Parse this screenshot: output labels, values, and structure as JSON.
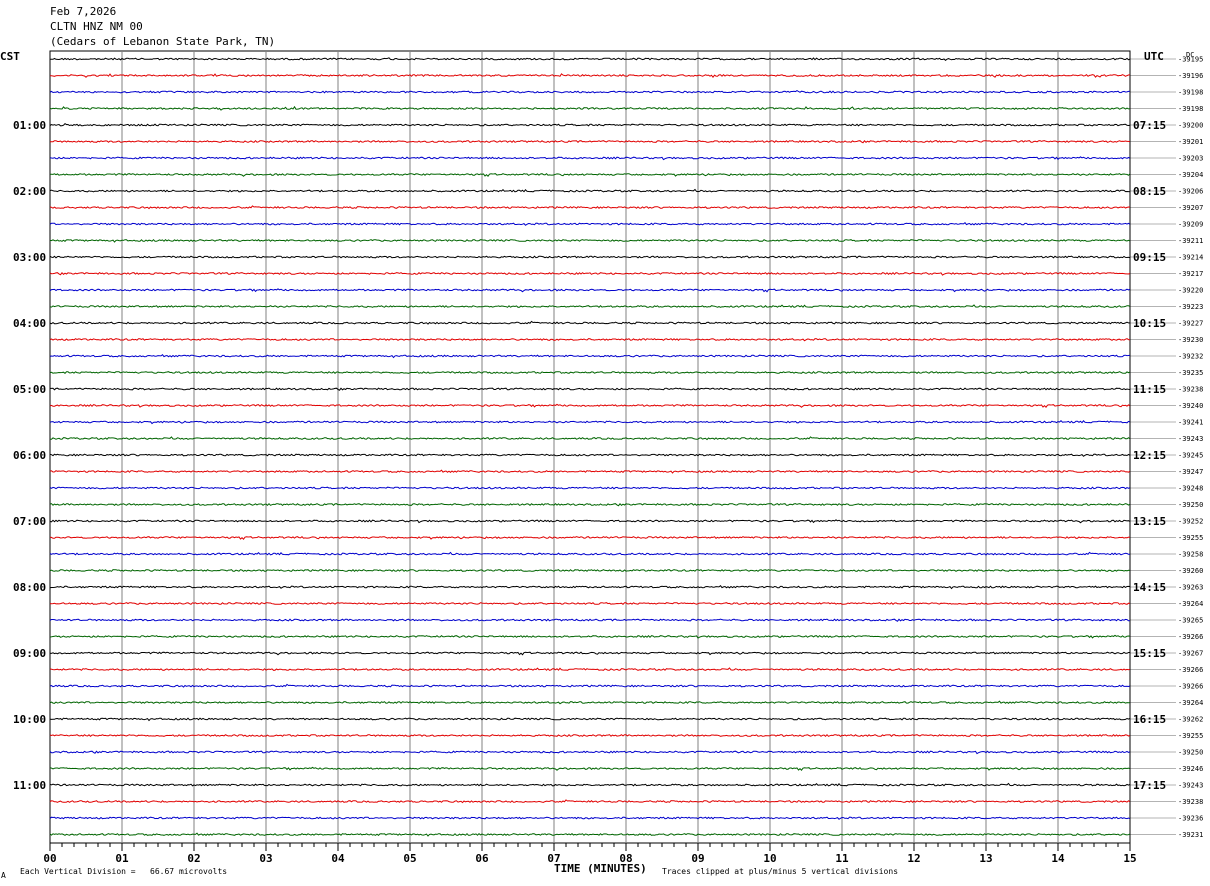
{
  "header": {
    "date": "Feb 7,2026",
    "station": "CLTN HNZ NM 00",
    "location": "(Cedars of Lebanon State Park, TN)"
  },
  "timezones": {
    "left": "CST",
    "right": "UTC"
  },
  "right_top_label": "DC",
  "footer": {
    "scale_note": "Each Vertical Division =   66.67 microvolts",
    "xlabel": "TIME (MINUTES)",
    "clip_note": "Traces clipped at plus/minus 5 vertical divisions",
    "corner_mark": "A"
  },
  "chart_data": {
    "type": "line",
    "title": "",
    "xlabel": "TIME (MINUTES)",
    "xlim": [
      0,
      15
    ],
    "x_ticks": [
      "00",
      "01",
      "02",
      "03",
      "04",
      "05",
      "06",
      "07",
      "08",
      "09",
      "10",
      "11",
      "12",
      "13",
      "14",
      "15"
    ],
    "trace_colors": [
      "#000000",
      "#e00000",
      "#0000cc",
      "#006400"
    ],
    "left_hour_labels": [
      "01:00",
      "02:00",
      "03:00",
      "04:00",
      "05:00",
      "06:00",
      "07:00",
      "08:00",
      "09:00",
      "10:00",
      "11:00"
    ],
    "right_hour_labels": [
      "07:15",
      "08:15",
      "09:15",
      "10:15",
      "11:15",
      "12:15",
      "13:15",
      "14:15",
      "15:15",
      "16:15",
      "17:15"
    ],
    "trace_offsets": [
      "-39195",
      "-39196",
      "-39198",
      "-39198",
      "-39200",
      "-39201",
      "-39203",
      "-39204",
      "-39206",
      "-39207",
      "-39209",
      "-39211",
      "-39214",
      "-39217",
      "-39220",
      "-39223",
      "-39227",
      "-39230",
      "-39232",
      "-39235",
      "-39238",
      "-39240",
      "-39241",
      "-39243",
      "-39245",
      "-39247",
      "-39248",
      "-39250",
      "-39252",
      "-39255",
      "-39258",
      "-39260",
      "-39263",
      "-39264",
      "-39265",
      "-39266",
      "-39267",
      "-39266",
      "-39266",
      "-39264",
      "-39262",
      "-39255",
      "-39250",
      "-39246",
      "-39243",
      "-39238",
      "-39236",
      "-39231"
    ]
  }
}
